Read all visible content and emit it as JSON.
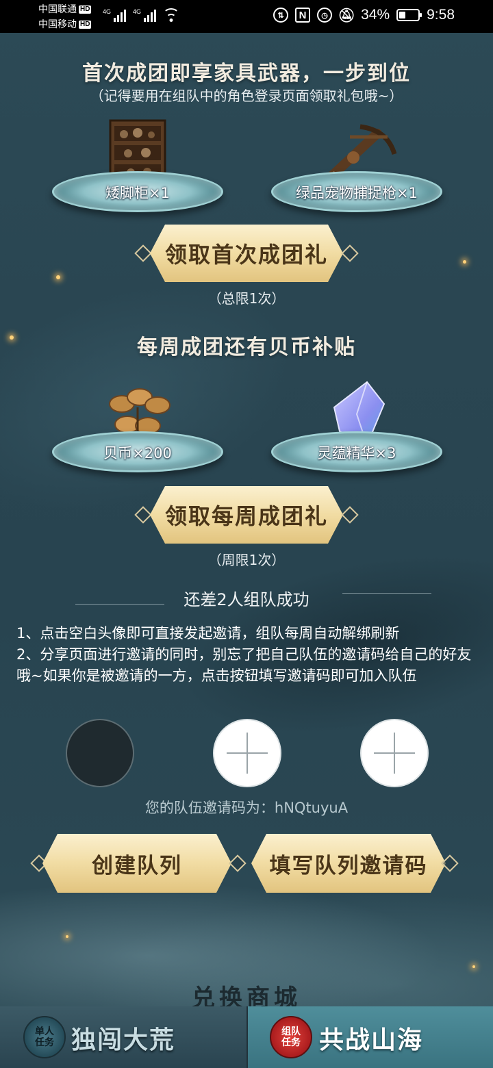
{
  "status_bar": {
    "carrier1": "中国联通",
    "carrier2": "中国移动",
    "hd_tag": "HD",
    "network": "4G",
    "nfc_label": "N",
    "battery_percent": "34%",
    "battery_level": 0.34,
    "time": "9:58"
  },
  "first_team": {
    "title": "首次成团即享家具武器，一步到位",
    "subtitle": "（记得要用在组队中的角色登录页面领取礼包哦~）",
    "items": [
      {
        "label": "矮脚柜×1"
      },
      {
        "label": "绿品宠物捕捉枪×1"
      }
    ],
    "claim_button": "领取首次成团礼",
    "limit": "（总限1次）"
  },
  "weekly_team": {
    "title": "每周成团还有贝币补贴",
    "items": [
      {
        "label": "贝币×200"
      },
      {
        "label": "灵蕴精华×3"
      }
    ],
    "claim_button": "领取每周成团礼",
    "limit": "（周限1次）"
  },
  "team": {
    "status": "还差2人组队成功",
    "rule1": "1、点击空白头像即可直接发起邀请，组队每周自动解绑刷新",
    "rule2": "2、分享页面进行邀请的同时，别忘了把自己队伍的邀请码给自己的好友哦~如果你是被邀请的一方，点击按钮填写邀请码即可加入队伍",
    "invite_code": "您的队伍邀请码为：hNQtuyuA",
    "create_button": "创建队列",
    "fill_code_button": "填写队列邀请码"
  },
  "shop_title": "兑换商城",
  "bottom_nav": {
    "left": {
      "badge_line1": "单人",
      "badge_line2": "任务",
      "label": "独闯大荒"
    },
    "right": {
      "badge_line1": "组队",
      "badge_line2": "任务",
      "label": "共战山海"
    }
  }
}
